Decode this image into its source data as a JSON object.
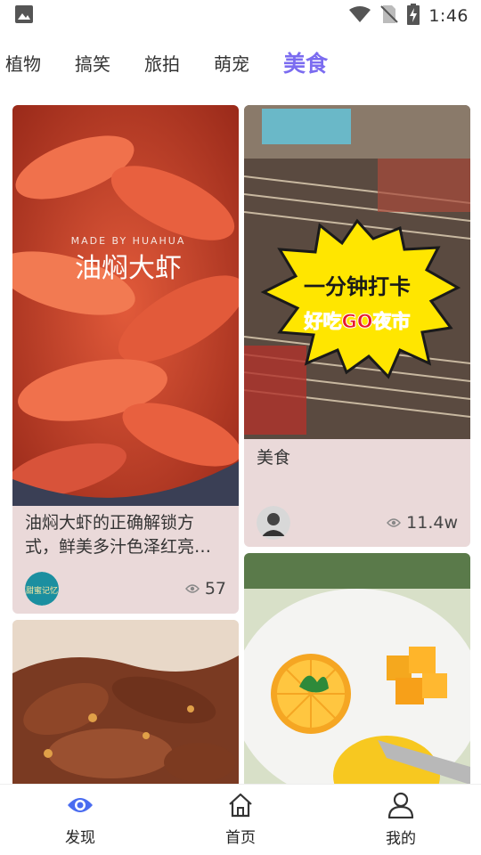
{
  "status_bar": {
    "time": "1:46",
    "icons": [
      "image-icon",
      "wifi-icon",
      "no-sim-icon",
      "battery-charging-icon"
    ]
  },
  "category_tabs": [
    {
      "label": "植物",
      "active": false
    },
    {
      "label": "搞笑",
      "active": false
    },
    {
      "label": "旅拍",
      "active": false
    },
    {
      "label": "萌宠",
      "active": false
    },
    {
      "label": "美食",
      "active": true
    }
  ],
  "colors": {
    "accent": "#7b6cf0",
    "card_background": "#ead9d9",
    "nav_active": "#4a6cf0"
  },
  "feed": {
    "cards": [
      {
        "image_text": "油焖大虾",
        "image_watermark": "MADE BY HUAHUA",
        "title": "油焖大虾的正确解锁方式，鲜美多汁色泽红亮…",
        "views": "57",
        "avatar_text": "甜蜜记忆"
      },
      {
        "image_text_line1": "一分钟打卡",
        "image_text_line2": "好吃GO夜市",
        "title": "美食",
        "views": "11.4w"
      },
      {
        "title": "",
        "views": ""
      },
      {
        "title": "",
        "views": ""
      }
    ]
  },
  "bottom_nav": [
    {
      "label": "发现",
      "icon": "eye-icon",
      "active": true
    },
    {
      "label": "首页",
      "icon": "home-icon",
      "active": false
    },
    {
      "label": "我的",
      "icon": "user-icon",
      "active": false
    }
  ]
}
